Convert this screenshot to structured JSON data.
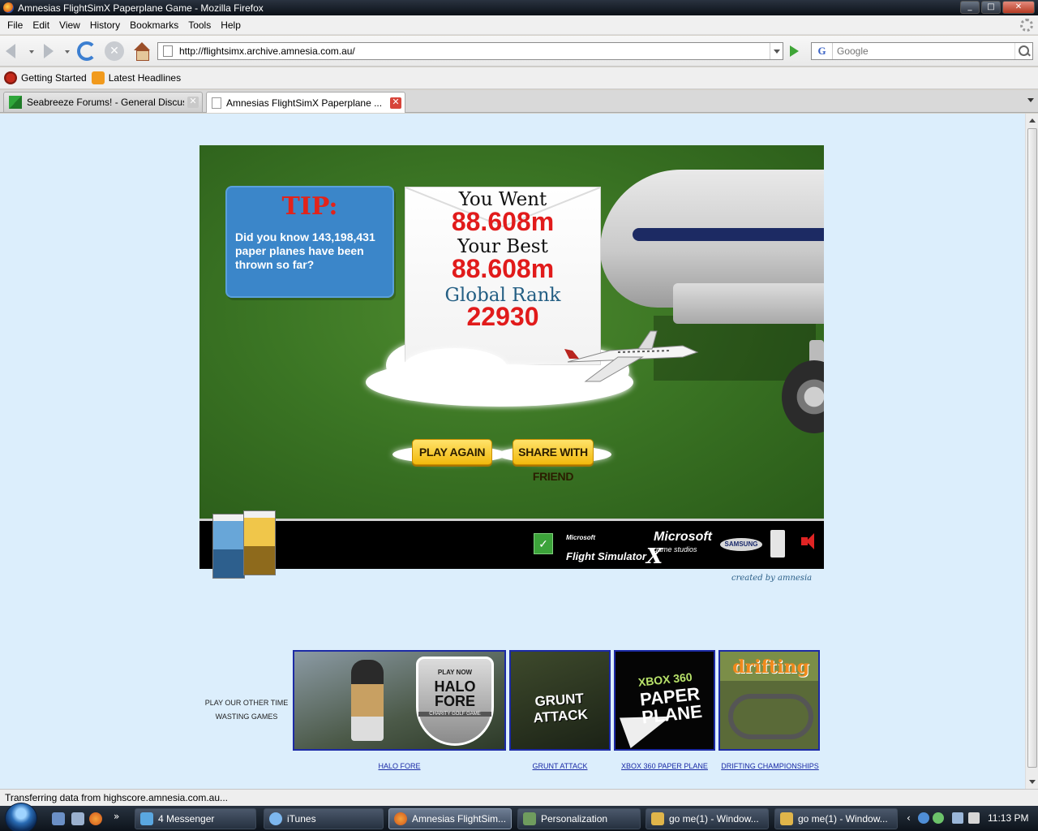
{
  "window": {
    "title": "Amnesias FlightSimX Paperplane Game - Mozilla Firefox",
    "controls": [
      "minimize",
      "maximize",
      "close"
    ]
  },
  "menu": [
    "File",
    "Edit",
    "View",
    "History",
    "Bookmarks",
    "Tools",
    "Help"
  ],
  "navigation": {
    "url": "http://flightsimx.archive.amnesia.com.au/",
    "search_placeholder": "Google"
  },
  "bookmarks": [
    "Getting Started",
    "Latest Headlines"
  ],
  "tabs": [
    {
      "label": "Seabreeze Forums! - General Discus...",
      "active": false
    },
    {
      "label": "Amnesias FlightSimX Paperplane ...",
      "active": true
    }
  ],
  "game": {
    "tip_title": "TIP:",
    "tip_text": "Did you know 143,198,431 paper planes have been thrown so far?",
    "you_went_label": "You Went",
    "you_went_value": "88.608m",
    "best_label": "Your Best",
    "best_value": "88.608m",
    "rank_label": "Global Rank",
    "rank_value": "22930",
    "play_again": "PLAY AGAIN",
    "share": "SHARE WITH FRIEND",
    "logos": {
      "green": "✓",
      "fsx_prefix": "Microsoft",
      "fsx_name": "Flight Simulator",
      "fsx_x": "X",
      "ms_name": "Microsoft",
      "ms_sub": "game studios",
      "samsung": "SAMSUNG"
    },
    "credit": "created by amnesia"
  },
  "other_games": {
    "label": "PLAY OUR OTHER TIME WASTING GAMES",
    "halo_play_now": "PLAY NOW",
    "halo_title": "HALO FORE",
    "halo_sub": "CHARITY GOLF GAME",
    "grunt_title": "GRUNT ATTACK",
    "xbox_top": "XBOX 360",
    "xbox_title": "PAPER PLANE",
    "drift_title": "drifting",
    "links": [
      "HALO FORE",
      "GRUNT ATTACK",
      "XBOX 360 PAPER PLANE",
      "DRIFTING CHAMPIONSHIPS"
    ]
  },
  "status": "Transferring data from highscore.amnesia.com.au...",
  "taskbar": {
    "quicklaunch_more": "»",
    "items": [
      {
        "label": "4 Messenger",
        "active": false
      },
      {
        "label": "iTunes",
        "active": false
      },
      {
        "label": "Amnesias FlightSim...",
        "active": true
      },
      {
        "label": "Personalization",
        "active": false
      },
      {
        "label": "go me(1) - Window...",
        "active": false
      },
      {
        "label": "go me(1) - Window...",
        "active": false
      }
    ],
    "clock": "11:13 PM"
  }
}
